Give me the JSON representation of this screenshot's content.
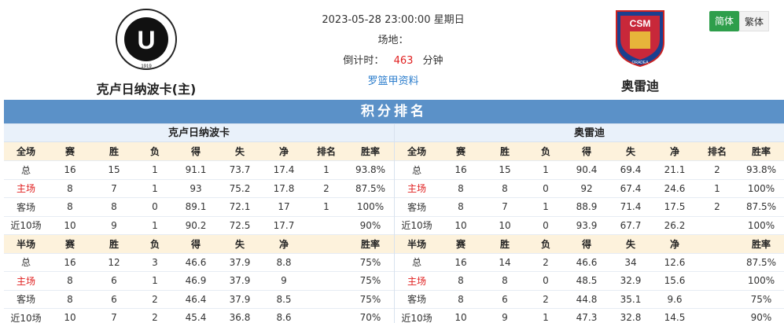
{
  "match": {
    "datetime": "2023-05-28 23:00:00 星期日",
    "venue_label": "场地：",
    "countdown_label": "倒计时：",
    "countdown_value": "463",
    "countdown_unit": "分钟",
    "league_link": "罗篮甲资料"
  },
  "home": {
    "name": "克卢日纳波卡(主)",
    "logo_year": "1919",
    "logo_ring": "F.C. UNIVERSITATEA CLUJ",
    "logo_letter": "U"
  },
  "away": {
    "name": "奥雷迪",
    "logo_text": "CSM",
    "logo_sub": "ORADEA"
  },
  "lang": {
    "simplified": "简体",
    "traditional": "繁体"
  },
  "standings": {
    "title": "积分排名",
    "home_team": "克卢日纳波卡",
    "away_team": "奥雷迪",
    "full_headers": [
      "全场",
      "赛",
      "胜",
      "负",
      "得",
      "失",
      "净",
      "排名",
      "胜率"
    ],
    "half_headers": [
      "半场",
      "赛",
      "胜",
      "负",
      "得",
      "失",
      "净",
      "",
      "胜率"
    ],
    "home_full": [
      [
        "总",
        "16",
        "15",
        "1",
        "91.1",
        "73.7",
        "17.4",
        "1",
        "93.8%"
      ],
      [
        "主场",
        "8",
        "7",
        "1",
        "93",
        "75.2",
        "17.8",
        "2",
        "87.5%"
      ],
      [
        "客场",
        "8",
        "8",
        "0",
        "89.1",
        "72.1",
        "17",
        "1",
        "100%"
      ],
      [
        "近10场",
        "10",
        "9",
        "1",
        "90.2",
        "72.5",
        "17.7",
        "",
        "90%"
      ]
    ],
    "home_half": [
      [
        "总",
        "16",
        "12",
        "3",
        "46.6",
        "37.9",
        "8.8",
        "",
        "75%"
      ],
      [
        "主场",
        "8",
        "6",
        "1",
        "46.9",
        "37.9",
        "9",
        "",
        "75%"
      ],
      [
        "客场",
        "8",
        "6",
        "2",
        "46.4",
        "37.9",
        "8.5",
        "",
        "75%"
      ],
      [
        "近10场",
        "10",
        "7",
        "2",
        "45.4",
        "36.8",
        "8.6",
        "",
        "70%"
      ]
    ],
    "away_full": [
      [
        "总",
        "16",
        "15",
        "1",
        "90.4",
        "69.4",
        "21.1",
        "2",
        "93.8%"
      ],
      [
        "主场",
        "8",
        "8",
        "0",
        "92",
        "67.4",
        "24.6",
        "1",
        "100%"
      ],
      [
        "客场",
        "8",
        "7",
        "1",
        "88.9",
        "71.4",
        "17.5",
        "2",
        "87.5%"
      ],
      [
        "近10场",
        "10",
        "10",
        "0",
        "93.9",
        "67.7",
        "26.2",
        "",
        "100%"
      ]
    ],
    "away_half": [
      [
        "总",
        "16",
        "14",
        "2",
        "46.6",
        "34",
        "12.6",
        "",
        "87.5%"
      ],
      [
        "主场",
        "8",
        "8",
        "0",
        "48.5",
        "32.9",
        "15.6",
        "",
        "100%"
      ],
      [
        "客场",
        "8",
        "6",
        "2",
        "44.8",
        "35.1",
        "9.6",
        "",
        "75%"
      ],
      [
        "近10场",
        "10",
        "9",
        "1",
        "47.3",
        "32.8",
        "14.5",
        "",
        "90%"
      ]
    ]
  },
  "colors": {
    "title_bar": "#5b91c8",
    "header_row": "#fdf2dc",
    "home_highlight": "#e02020",
    "active_lang": "#2e9e4b"
  }
}
